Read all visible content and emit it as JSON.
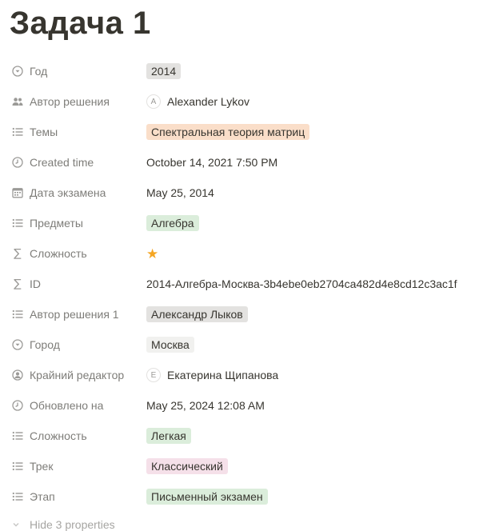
{
  "page": {
    "title": "Задача 1"
  },
  "colors": {
    "gray_tag": "#e3e2e0",
    "orange_tag": "#fadec9",
    "green_tag": "#dbeddb",
    "pink_tag": "#f5e0e9",
    "light_gray_tag": "#f1f1ef",
    "star": "#f5a623"
  },
  "properties": [
    {
      "icon": "select-icon",
      "name": "Год",
      "value": "2014",
      "kind": "tag",
      "color": "gray_tag"
    },
    {
      "icon": "people-icon",
      "name": "Автор решения",
      "value": "Alexander Lykov",
      "avatar": "A",
      "kind": "person"
    },
    {
      "icon": "list-icon",
      "name": "Темы",
      "value": "Спектральная теория матриц",
      "kind": "tag",
      "color": "orange_tag"
    },
    {
      "icon": "clock-icon",
      "name": "Created time",
      "value": "October 14, 2021 7:50 PM",
      "kind": "text"
    },
    {
      "icon": "calendar-icon",
      "name": "Дата экзамена",
      "value": "May 25, 2014",
      "kind": "text"
    },
    {
      "icon": "list-icon",
      "name": "Предметы",
      "value": "Алгебра",
      "kind": "tag",
      "color": "green_tag"
    },
    {
      "icon": "sigma-icon",
      "name": "Сложность",
      "value": "★",
      "kind": "star"
    },
    {
      "icon": "sigma-icon",
      "name": "ID",
      "value": "2014-Алгебра-Москва-3b4ebe0eb2704ca482d4e8cd12c3ac1f",
      "kind": "text"
    },
    {
      "icon": "list-icon",
      "name": "Автор решения 1",
      "value": "Александр Лыков",
      "kind": "tag",
      "color": "gray_tag"
    },
    {
      "icon": "select-icon",
      "name": "Город",
      "value": "Москва",
      "kind": "tag",
      "color": "light_gray_tag"
    },
    {
      "icon": "person-circle-icon",
      "name": "Крайний редактор",
      "value": "Екатерина Щипанова",
      "avatar": "E",
      "kind": "person"
    },
    {
      "icon": "clock-icon",
      "name": "Обновлено на",
      "value": "May 25, 2024 12:08 AM",
      "kind": "text"
    },
    {
      "icon": "list-icon",
      "name": "Сложность",
      "value": "Легкая",
      "kind": "tag",
      "color": "green_tag"
    },
    {
      "icon": "list-icon",
      "name": "Трек",
      "value": "Классический",
      "kind": "tag",
      "color": "pink_tag"
    },
    {
      "icon": "list-icon",
      "name": "Этап",
      "value": "Письменный экзамен",
      "kind": "tag",
      "color": "green_tag"
    }
  ],
  "footer": {
    "hide_label": "Hide 3 properties"
  }
}
